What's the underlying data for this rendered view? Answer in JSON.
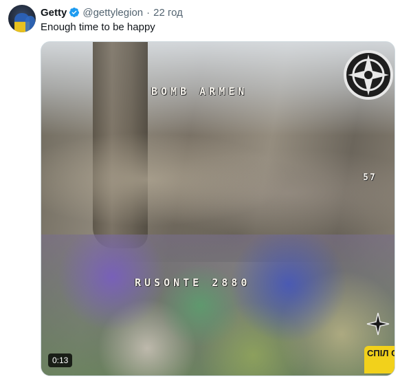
{
  "author": {
    "display_name": "Getty",
    "handle": "@gettylegion",
    "separator": "·",
    "time": "22 год"
  },
  "tweet": {
    "text": "Enough time to be happy"
  },
  "media": {
    "overlay_top": "BOMB ARMEN",
    "overlay_bottom": "RUSONTE 2880",
    "overlay_number": "57",
    "duration": "0:13",
    "watermark": "СПІЛ СТЕР"
  },
  "colors": {
    "verified": "#1d9bf0",
    "text_primary": "#0f1419",
    "text_secondary": "#536471",
    "watermark_bg": "#f2d11b"
  },
  "icons": {
    "verified": "verified-badge-icon",
    "emblem": "unit-emblem-icon",
    "star": "star-decoration-icon"
  }
}
